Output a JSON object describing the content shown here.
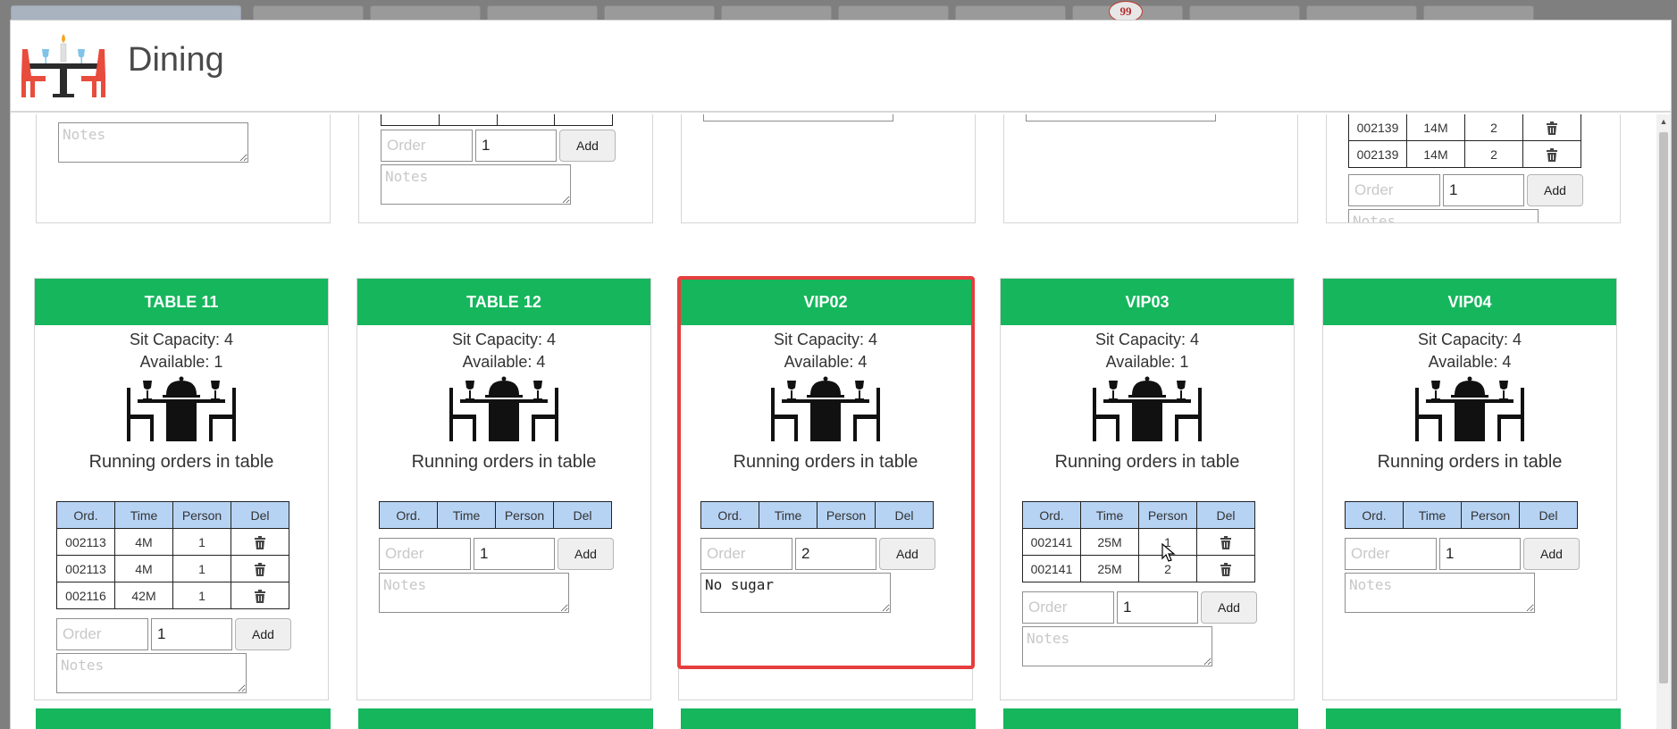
{
  "modal": {
    "title": "Dining"
  },
  "background": {
    "badge_count": "99"
  },
  "columns": {
    "ord": "Ord.",
    "time": "Time",
    "person": "Person",
    "del": "Del"
  },
  "labels": {
    "sit_capacity_prefix": "Sit Capacity: ",
    "available_prefix": "Available: ",
    "running_orders": "Running orders in table",
    "order_placeholder": "Order",
    "notes_placeholder": "Notes",
    "add_button": "Add"
  },
  "top_partial": {
    "table5_rows": [
      {
        "ord": "002139",
        "time": "14M",
        "person": "2"
      },
      {
        "ord": "002139",
        "time": "14M",
        "person": "2"
      }
    ],
    "qty": [
      "1",
      "1"
    ]
  },
  "tables": [
    {
      "name": "TABLE 11",
      "capacity": "Sit Capacity: 4",
      "available": "Available: 1",
      "orders": [
        {
          "ord": "002113",
          "time": "4M",
          "person": "1"
        },
        {
          "ord": "002113",
          "time": "4M",
          "person": "1"
        },
        {
          "ord": "002116",
          "time": "42M",
          "person": "1"
        }
      ],
      "qty": "1",
      "notes": ""
    },
    {
      "name": "TABLE 12",
      "capacity": "Sit Capacity: 4",
      "available": "Available: 4",
      "orders": [],
      "qty": "1",
      "notes": ""
    },
    {
      "name": "VIP02",
      "capacity": "Sit Capacity: 4",
      "available": "Available: 4",
      "orders": [],
      "qty": "2",
      "notes": "No sugar",
      "selected": true
    },
    {
      "name": "VIP03",
      "capacity": "Sit Capacity: 4",
      "available": "Available: 1",
      "orders": [
        {
          "ord": "002141",
          "time": "25M",
          "person": "1"
        },
        {
          "ord": "002141",
          "time": "25M",
          "person": "2"
        }
      ],
      "qty": "1",
      "notes": ""
    },
    {
      "name": "VIP04",
      "capacity": "Sit Capacity: 4",
      "available": "Available: 4",
      "orders": [],
      "qty": "1",
      "notes": ""
    }
  ],
  "colors": {
    "header_green": "#16b65d",
    "column_header_blue": "#b7d3f4",
    "selection_red": "#e53e3e"
  }
}
